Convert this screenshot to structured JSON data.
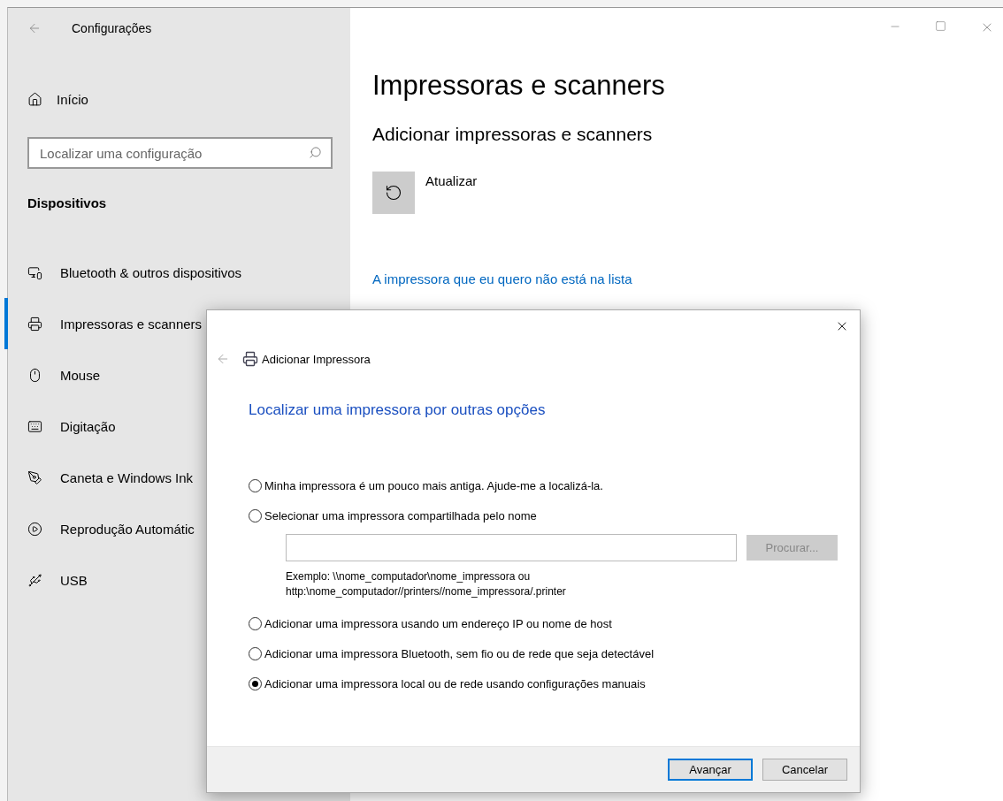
{
  "window": {
    "title": "Configurações"
  },
  "sidebar": {
    "home": "Início",
    "search": {
      "placeholder": "Localizar uma configuração"
    },
    "section": "Dispositivos",
    "items": [
      {
        "label": "Bluetooth & outros dispositivos",
        "selected": false
      },
      {
        "label": "Impressoras e scanners",
        "selected": true
      },
      {
        "label": "Mouse",
        "selected": false
      },
      {
        "label": "Digitação",
        "selected": false
      },
      {
        "label": "Caneta e Windows Ink",
        "selected": false
      },
      {
        "label": "Reprodução Automátic",
        "selected": false
      },
      {
        "label": "USB",
        "selected": false
      }
    ]
  },
  "main": {
    "title": "Impressoras e scanners",
    "subtitle": "Adicionar impressoras e scanners",
    "refresh_label": "Atualizar",
    "link": "A impressora que eu quero não está na lista"
  },
  "dialog": {
    "title": "Adicionar Impressora",
    "heading": "Localizar uma impressora por outras opções",
    "options": [
      {
        "label": "Minha impressora é um pouco mais antiga. Ajude-me a localizá-la.",
        "selected": false
      },
      {
        "label": "Selecionar uma impressora compartilhada pelo nome",
        "selected": false,
        "name_entry": {
          "browse_button": {
            "label": "Procurar...",
            "disabled": true
          },
          "example": [
            "Exemplo: \\\\nome_computador\\nome_impressora ou",
            "http:\\nome_computador//printers//nome_impressora/.printer"
          ]
        }
      },
      {
        "label": "Adicionar uma impressora usando um endereço IP ou nome de host",
        "selected": false
      },
      {
        "label": "Adicionar uma impressora Bluetooth, sem fio ou de rede que seja detectável",
        "selected": false
      },
      {
        "label": "Adicionar uma impressora local ou de rede usando configurações manuais",
        "selected": true
      }
    ],
    "buttons": [
      {
        "label": "Avançar",
        "default": true
      },
      {
        "label": "Cancelar",
        "default": false
      }
    ]
  }
}
